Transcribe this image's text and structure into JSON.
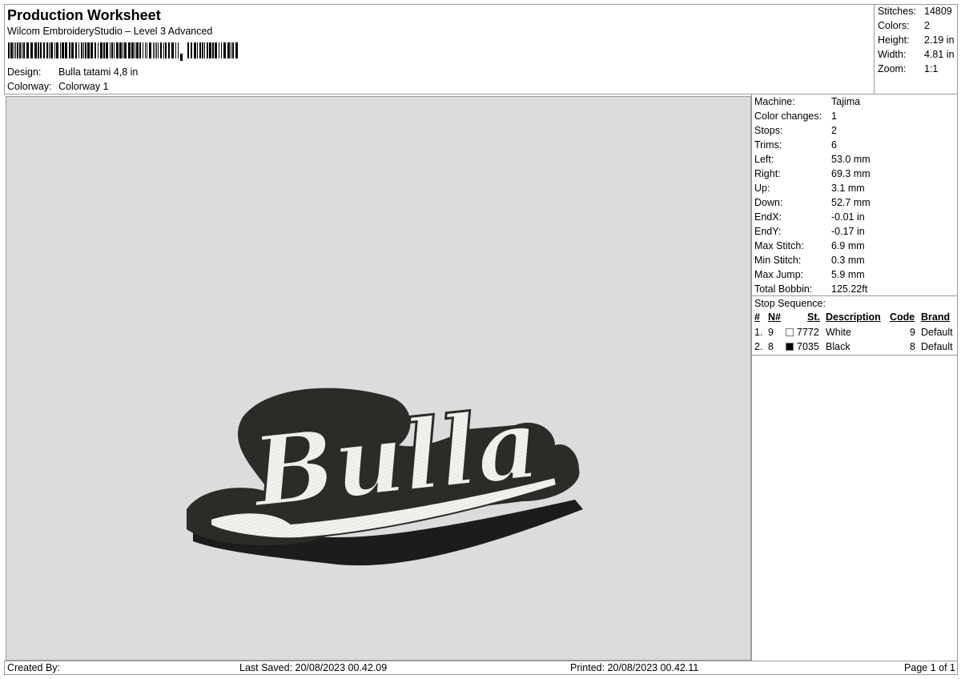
{
  "header": {
    "title": "Production Worksheet",
    "subtitle": "Wilcom EmbroideryStudio – Level 3 Advanced",
    "design_label": "Design:",
    "design_value": "Bulla tatami 4,8 in",
    "colorway_label": "Colorway:",
    "colorway_value": "Colorway 1"
  },
  "summary": [
    {
      "label": "Stitches:",
      "value": "14809"
    },
    {
      "label": "Colors:",
      "value": "2"
    },
    {
      "label": "Height:",
      "value": "2.19 in"
    },
    {
      "label": "Width:",
      "value": "4.81 in"
    },
    {
      "label": "Zoom:",
      "value": "1:1"
    }
  ],
  "design_art": {
    "text": "Bulla",
    "fill_color": "#f2f2ee",
    "outline_color": "#2b2b28",
    "shadow_color": "#1c1c1a"
  },
  "machine_info": [
    {
      "label": "Machine:",
      "value": "Tajima"
    },
    {
      "label": "Color changes:",
      "value": "1"
    },
    {
      "label": "Stops:",
      "value": "2"
    },
    {
      "label": "Trims:",
      "value": "6"
    },
    {
      "label": "Left:",
      "value": "53.0 mm"
    },
    {
      "label": "Right:",
      "value": "69.3 mm"
    },
    {
      "label": "Up:",
      "value": "3.1 mm"
    },
    {
      "label": "Down:",
      "value": "52.7 mm"
    },
    {
      "label": "EndX:",
      "value": "-0.01 in"
    },
    {
      "label": "EndY:",
      "value": "-0.17 in"
    },
    {
      "label": "Max Stitch:",
      "value": "6.9 mm"
    },
    {
      "label": "Min Stitch:",
      "value": "0.3 mm"
    },
    {
      "label": "Max Jump:",
      "value": "5.9 mm"
    },
    {
      "label": "Total Bobbin:",
      "value": "125.22ft"
    }
  ],
  "stop_sequence": {
    "title": "Stop Sequence:",
    "headers": {
      "num": "#",
      "n": "N#",
      "st": "St.",
      "description": "Description",
      "code": "Code",
      "brand": "Brand"
    },
    "rows": [
      {
        "num": "1.",
        "n": "9",
        "swatch": "#ffffff",
        "st": "7772",
        "description": "White",
        "code": "9",
        "brand": "Default"
      },
      {
        "num": "2.",
        "n": "8",
        "swatch": "#000000",
        "st": "7035",
        "description": "Black",
        "code": "8",
        "brand": "Default"
      }
    ]
  },
  "footer": {
    "created_by": "Created By:",
    "last_saved": "Last Saved: 20/08/2023 00.42.09",
    "printed": "Printed: 20/08/2023 00.42.11",
    "page": "Page 1 of 1"
  }
}
